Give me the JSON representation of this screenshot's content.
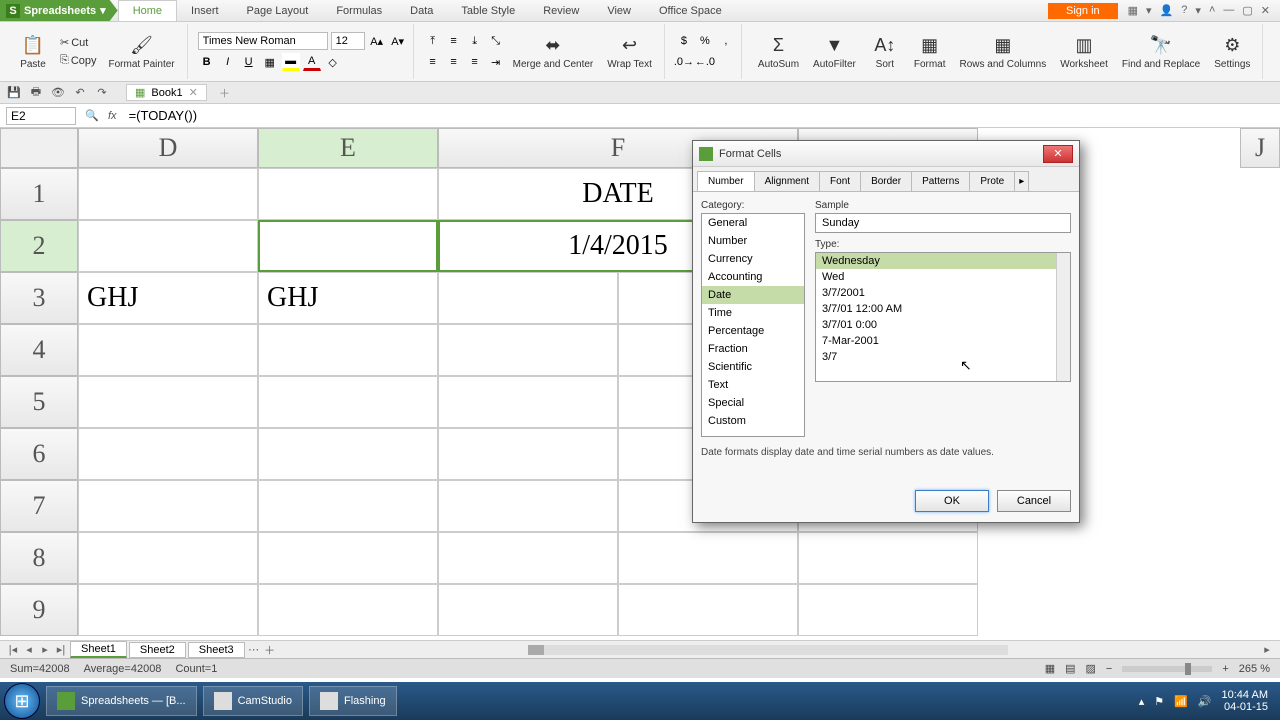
{
  "app": {
    "name": "Spreadsheets"
  },
  "menu_tabs": [
    "Home",
    "Insert",
    "Page Layout",
    "Formulas",
    "Data",
    "Table Style",
    "Review",
    "View",
    "Office Space"
  ],
  "active_tab": "Home",
  "signin": "Sign in",
  "win_icons": [
    "⊞",
    "▾",
    "👤",
    "?",
    "▾",
    "^",
    "—",
    "▢",
    "✕"
  ],
  "ribbon": {
    "paste": "Paste",
    "cut": "Cut",
    "copy": "Copy",
    "fmtpainter": "Format\nPainter",
    "font": "Times New Roman",
    "size": "12",
    "merge": "Merge and Center",
    "wrap": "Wrap Text",
    "autosum": "AutoSum",
    "autofilter": "AutoFilter",
    "sort": "Sort",
    "format": "Format",
    "rowscols": "Rows and\nColumns",
    "worksheet": "Worksheet",
    "findrep": "Find and\nReplace",
    "settings": "Settings"
  },
  "doc": {
    "name": "Book1"
  },
  "cellref": "E2",
  "formula": "=(TODAY())",
  "cols": {
    "D": "D",
    "E": "E",
    "F": "F",
    "J": "J"
  },
  "cells": {
    "F1": "DATE",
    "F2": "1/4/2015",
    "D3": "GHJ",
    "E3": "GHJ"
  },
  "col_widths": {
    "D": 180,
    "E": 180,
    "F": 360,
    "G": 180
  },
  "sheets": [
    "Sheet1",
    "Sheet2",
    "Sheet3"
  ],
  "status": {
    "sum": "Sum=42008",
    "avg": "Average=42008",
    "count": "Count=1",
    "zoom": "265 %"
  },
  "dialog": {
    "title": "Format Cells",
    "tabs": [
      "Number",
      "Alignment",
      "Font",
      "Border",
      "Patterns",
      "Prote"
    ],
    "active": "Number",
    "category_label": "Category:",
    "categories": [
      "General",
      "Number",
      "Currency",
      "Accounting",
      "Date",
      "Time",
      "Percentage",
      "Fraction",
      "Scientific",
      "Text",
      "Special",
      "Custom"
    ],
    "selected_cat": "Date",
    "sample_label": "Sample",
    "sample_value": "Sunday",
    "type_label": "Type:",
    "types": [
      "Wednesday",
      "Wed",
      "3/7/2001",
      "3/7/01 12:00 AM",
      "3/7/01 0:00",
      "7-Mar-2001",
      "3/7"
    ],
    "selected_type": "Wednesday",
    "desc": "Date formats display date and time serial numbers as date values.",
    "ok": "OK",
    "cancel": "Cancel"
  },
  "taskbar": {
    "items": [
      {
        "label": "Spreadsheets — [B..."
      },
      {
        "label": "CamStudio"
      },
      {
        "label": "Flashing"
      }
    ],
    "time": "10:44 AM",
    "date": "04-01-15"
  }
}
